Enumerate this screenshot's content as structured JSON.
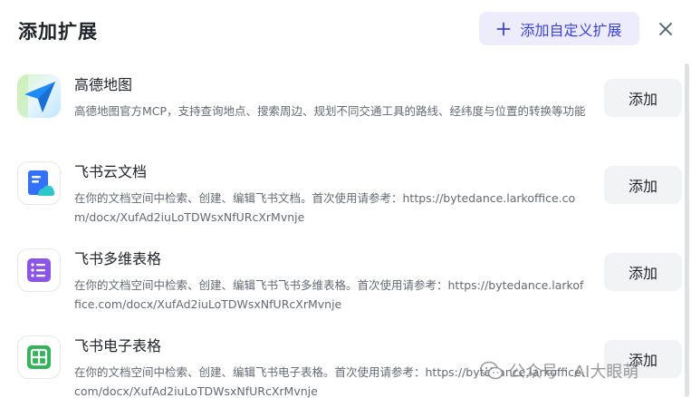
{
  "dialog": {
    "title": "添加扩展",
    "custom_button_label": "添加自定义扩展",
    "close_icon": "close-icon"
  },
  "items": [
    {
      "name": "高德地图",
      "description": "高德地图官方MCP，支持查询地点、搜索周边、规划不同交通工具的路线、经纬度与位置的转换等功能",
      "button_label": "添加",
      "icon": "amap-logo-icon"
    },
    {
      "name": "飞书云文档",
      "description": "在你的文档空间中检索、创建、编辑飞书文档。首次使用请参考：https://bytedance.larkoffice.com/docx/XufAd2iuLoTDWsxNfURcXrMvnje",
      "button_label": "添加",
      "icon": "feishu-doc-icon"
    },
    {
      "name": "飞书多维表格",
      "description": "在你的文档空间中检索、创建、编辑飞书飞书多维表格。首次使用请参考：https://bytedance.larkoffice.com/docx/XufAd2iuLoTDWsxNfURcXrMvnje",
      "button_label": "添加",
      "icon": "feishu-bitable-icon"
    },
    {
      "name": "飞书电子表格",
      "description": "在你的文档空间中检索、创建、编辑飞书电子表格。首次使用请参考：https://bytedance.larkoffice.com/docx/XufAd2iuLoTDWsxNfURcXrMvnje",
      "button_label": "添加",
      "icon": "feishu-sheet-icon"
    }
  ],
  "watermark": {
    "source": "公众号",
    "separator": "·",
    "name": "AI大眼萌"
  },
  "colors": {
    "accent": "#3c41d8",
    "accent_bg": "#ececfd",
    "amap_blue": "#1f8cf5",
    "doc_blue": "#3370ff",
    "bitable_purple": "#8b55e8",
    "sheet_green": "#33b35a"
  }
}
